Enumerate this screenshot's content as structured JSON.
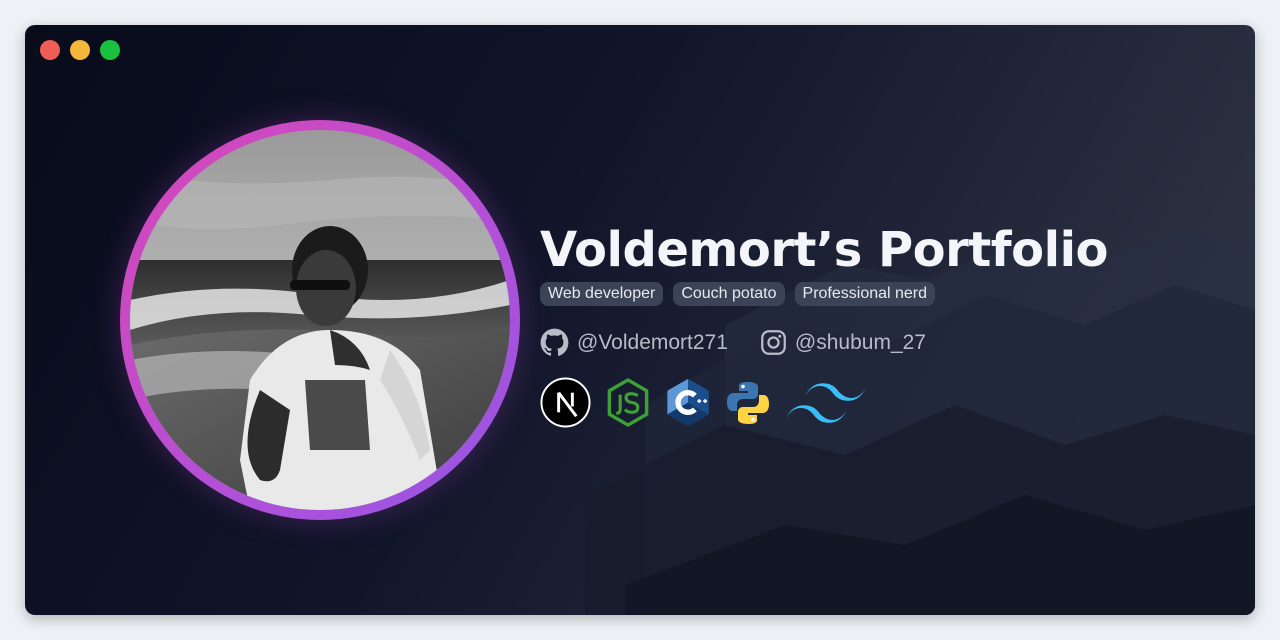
{
  "window": {
    "controls": [
      "close",
      "minimize",
      "maximize"
    ],
    "colors": {
      "close": "#ee5e57",
      "minimize": "#f4b73a",
      "maximize": "#19c13f"
    }
  },
  "profile": {
    "title": "Voldemort’s Portfolio",
    "tags": [
      "Web developer",
      "Couch potato",
      "Professional nerd"
    ],
    "avatar_icon": "profile-photo",
    "ring_gradient": [
      "#d946b5",
      "#9356e6"
    ]
  },
  "socials": [
    {
      "icon": "github-icon",
      "handle": "@Voldemort271"
    },
    {
      "icon": "instagram-icon",
      "handle": "@shubum_27"
    }
  ],
  "tech_stack": [
    "nextjs-icon",
    "nodejs-icon",
    "cplusplus-icon",
    "python-icon",
    "tailwind-icon"
  ]
}
